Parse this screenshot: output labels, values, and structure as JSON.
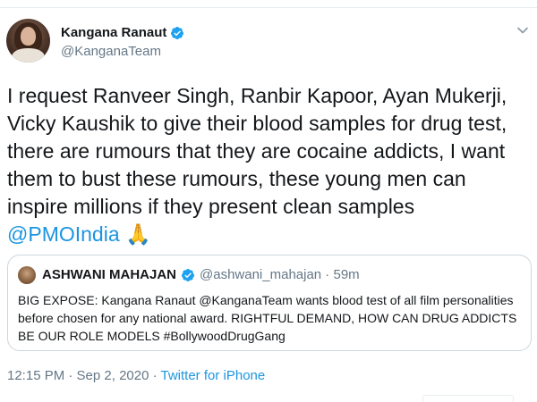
{
  "tweet": {
    "author": {
      "display_name": "Kangana Ranaut",
      "handle": "@KanganaTeam"
    },
    "text_lines": [
      "I request Ranveer Singh, Ranbir Kapoor, Ayan Mukerji,",
      "Vicky Kaushik to give their blood samples for drug test,",
      "there are rumours that they are cocaine addicts, I want",
      "them to bust these rumours, these young men can",
      "inspire millions if they present clean samples"
    ],
    "mention": "@PMOIndia",
    "emoji": "🙏",
    "timestamp": "12:15 PM · Sep 2, 2020 · ",
    "source": "Twitter for iPhone"
  },
  "quote": {
    "author": {
      "display_name": "ASHWANI MAHAJAN",
      "handle_time": "@ashwani_mahajan · 59m"
    },
    "text": "BIG EXPOSE: Kangana Ranaut @KanganaTeam wants blood test of all film personalities before chosen for any national award. RIGHTFUL DEMAND, HOW CAN DRUG ADDICTS BE OUR ROLE MODELS #BollywoodDrugGang"
  },
  "colors": {
    "link": "#1b95e0",
    "verified": "#1da1f2",
    "secondary_text": "#657786",
    "border": "#ccd6dd"
  },
  "icons": {
    "verified": "verified-badge-icon",
    "caret": "chevron-down-icon",
    "emoji": "folded-hands-emoji"
  }
}
